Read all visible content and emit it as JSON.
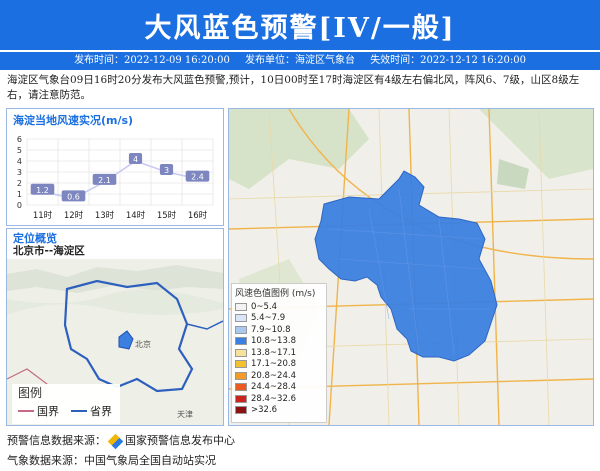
{
  "header": {
    "title": "大风蓝色预警[IV/一般]",
    "issue_time": "发布时间：2022-12-09 16:20:00",
    "issuer": "发布单位：海淀区气象台",
    "expire_time": "失效时间：2022-12-12 16:20:00"
  },
  "description": "海淀区气象台09日16时20分发布大风蓝色预警,预计，10日00时至17时海淀区有4级左右偏北风，阵风6、7级，山区8级左右，请注意防范。",
  "wind_panel": {
    "title": "海淀当地风速实况(m/s)"
  },
  "chart_data": {
    "type": "line",
    "categories": [
      "11时",
      "12时",
      "13时",
      "14时",
      "15时",
      "16时"
    ],
    "values": [
      1.2,
      0.6,
      2.1,
      4,
      3,
      2.4
    ],
    "value_labels": [
      "1.2",
      "0.6",
      "2.1",
      "4",
      "3",
      "2.4"
    ],
    "ylim": [
      0,
      6
    ],
    "yticks": [
      "0",
      "1",
      "2",
      "3",
      "4",
      "5",
      "6"
    ],
    "grid": true,
    "colors": {
      "line": "#c9c9f2",
      "label_bg": "#7e86bf"
    }
  },
  "location_panel": {
    "title": "定位概览",
    "subtitle": "北京市--海淀区",
    "legend_title": "图例",
    "legend_items": [
      {
        "label": "国界",
        "color": "#c46a85"
      },
      {
        "label": "省界",
        "color": "#2d5fbe"
      }
    ],
    "place_labels": [
      "北京",
      "天津"
    ]
  },
  "map_legend": {
    "title": "风速色值图例 (m/s)",
    "items": [
      {
        "label": "0~5.4",
        "color": "#f3f3f3"
      },
      {
        "label": "5.4~7.9",
        "color": "#d8e6f7"
      },
      {
        "label": "7.9~10.8",
        "color": "#a9c9f1"
      },
      {
        "label": "10.8~13.8",
        "color": "#3b7fe0"
      },
      {
        "label": "13.8~17.1",
        "color": "#f6e29a"
      },
      {
        "label": "17.1~20.8",
        "color": "#f2c230"
      },
      {
        "label": "20.8~24.4",
        "color": "#f39b2a"
      },
      {
        "label": "24.4~28.4",
        "color": "#eb5a1e"
      },
      {
        "label": "28.4~32.6",
        "color": "#c9241d"
      },
      {
        "label": ">32.6",
        "color": "#8b1212"
      }
    ]
  },
  "footer": {
    "source_label": "预警信息数据来源：",
    "source_name": "国家预警信息发布中心",
    "weather_source": "气象数据来源：中国气象局全国自动站实况"
  },
  "colors": {
    "header_bg": "#1b6fe0",
    "region_fill": "#3b7fe0"
  }
}
